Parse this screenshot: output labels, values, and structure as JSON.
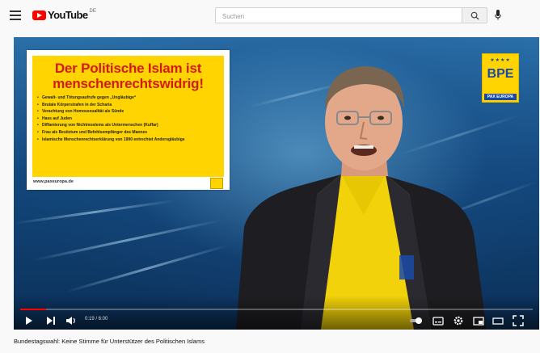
{
  "header": {
    "logo_text": "YouTube",
    "logo_country": "DE",
    "search_placeholder": "Suchen"
  },
  "video": {
    "panel": {
      "title": "Der Politische Islam ist menschenrechtswidrig!",
      "bullets": [
        "Gewalt- und Tötungsaufrufe gegen „Ungläubige“",
        "Brutale Körperstrafen in der Scharia",
        "Verachtung von Homosexualität als Sünde",
        "Hass auf Juden",
        "Diffamierung von Nichtmoslems als Untermenschen (Kuffar)",
        "Frau als Besitztum und Befehlsempfänger des Mannes",
        "Islamische Menschenrechtserklärung von 1990 entrechtet Andersgläubige"
      ],
      "url": "www.paxeuropa.de"
    },
    "bpe_logo": {
      "text": "BPE",
      "sub": "PAX EUROPA"
    },
    "controls": {
      "time": "0:19 / 6:00",
      "progress_fraction": 0.05
    }
  },
  "title": "Bundestagswahl: Keine Stimme für Unterstützer des Politischen Islams"
}
